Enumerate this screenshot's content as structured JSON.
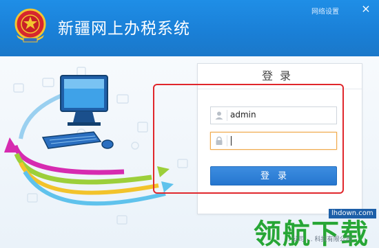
{
  "app": {
    "title": "新疆网上办税系统",
    "network_settings": "网络设置",
    "close_glyph": "×"
  },
  "login": {
    "heading": "登录",
    "username_value": "admin",
    "password_value": "",
    "button_label": "登录"
  },
  "watermark": {
    "text": "领航下载",
    "url": "lhdown.com"
  },
  "footer": {
    "text": "… 公司 … 科技有限公司"
  },
  "colors": {
    "titlebar": "#1a7fd6",
    "button": "#2576cf",
    "highlight": "#e0262b",
    "watermark_green": "#27a636"
  },
  "icons": {
    "emblem": "national-tax-emblem-icon",
    "user": "user-icon",
    "lock": "lock-icon",
    "close": "close-icon"
  }
}
